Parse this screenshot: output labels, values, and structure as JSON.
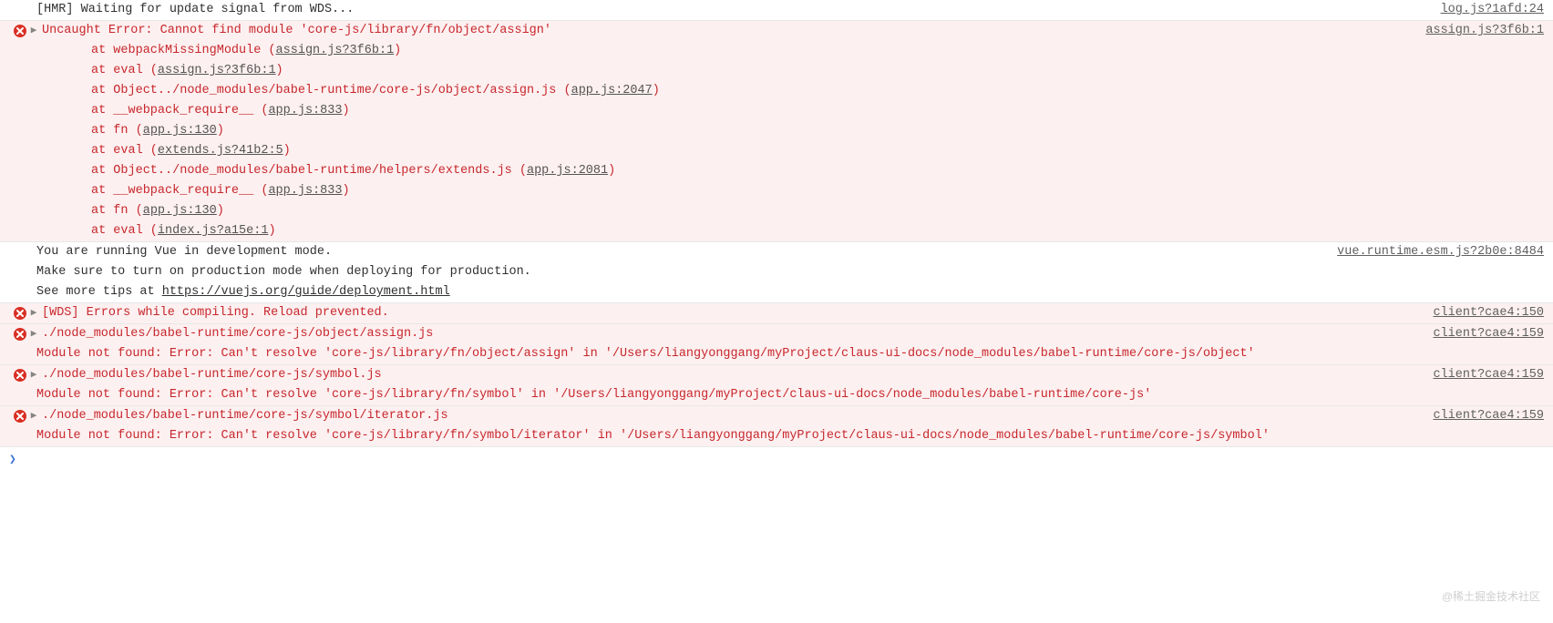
{
  "colors": {
    "error_text": "#c7272d",
    "error_bg": "#fdf0f0"
  },
  "rows": [
    {
      "id": "hmr",
      "type": "log",
      "text": "[HMR] Waiting for update signal from WDS...",
      "source": "log.js?1afd:24"
    },
    {
      "id": "uncaught",
      "type": "error-expanded",
      "head": "Uncaught Error: Cannot find module 'core-js/library/fn/object/assign'",
      "source": "assign.js?3f6b:1",
      "stack": [
        {
          "pre": "at webpackMissingModule (",
          "link": "assign.js?3f6b:1",
          "post": ")"
        },
        {
          "pre": "at eval (",
          "link": "assign.js?3f6b:1",
          "post": ")"
        },
        {
          "pre": "at Object../node_modules/babel-runtime/core-js/object/assign.js (",
          "link": "app.js:2047",
          "post": ")"
        },
        {
          "pre": "at __webpack_require__ (",
          "link": "app.js:833",
          "post": ")"
        },
        {
          "pre": "at fn (",
          "link": "app.js:130",
          "post": ")"
        },
        {
          "pre": "at eval (",
          "link": "extends.js?41b2:5",
          "post": ")"
        },
        {
          "pre": "at Object../node_modules/babel-runtime/helpers/extends.js (",
          "link": "app.js:2081",
          "post": ")"
        },
        {
          "pre": "at __webpack_require__ (",
          "link": "app.js:833",
          "post": ")"
        },
        {
          "pre": "at fn (",
          "link": "app.js:130",
          "post": ")"
        },
        {
          "pre": "at eval (",
          "link": "index.js?a15e:1",
          "post": ")"
        }
      ]
    },
    {
      "id": "vue-dev",
      "type": "info",
      "lines": [
        "You are running Vue in development mode.",
        "Make sure to turn on production mode when deploying for production.",
        "See more tips at "
      ],
      "tips_link": "https://vuejs.org/guide/deployment.html",
      "source": "vue.runtime.esm.js?2b0e:8484"
    },
    {
      "id": "wds-err",
      "type": "error",
      "head": "[WDS] Errors while compiling. Reload prevented.",
      "source": "client?cae4:150"
    },
    {
      "id": "mod-assign",
      "type": "error",
      "head": "./node_modules/babel-runtime/core-js/object/assign.js",
      "detail": "Module not found: Error: Can't resolve 'core-js/library/fn/object/assign' in '/Users/liangyonggang/myProject/claus-ui-docs/node_modules/babel-runtime/core-js/object'",
      "source": "client?cae4:159"
    },
    {
      "id": "mod-symbol",
      "type": "error",
      "head": "./node_modules/babel-runtime/core-js/symbol.js",
      "detail": "Module not found: Error: Can't resolve 'core-js/library/fn/symbol' in '/Users/liangyonggang/myProject/claus-ui-docs/node_modules/babel-runtime/core-js'",
      "source": "client?cae4:159"
    },
    {
      "id": "mod-iterator",
      "type": "error",
      "head": "./node_modules/babel-runtime/core-js/symbol/iterator.js",
      "detail": "Module not found: Error: Can't resolve 'core-js/library/fn/symbol/iterator' in '/Users/liangyonggang/myProject/claus-ui-docs/node_modules/babel-runtime/core-js/symbol'",
      "source": "client?cae4:159"
    }
  ],
  "watermark": "@稀土掘金技术社区",
  "prompt_chevron": "❯"
}
